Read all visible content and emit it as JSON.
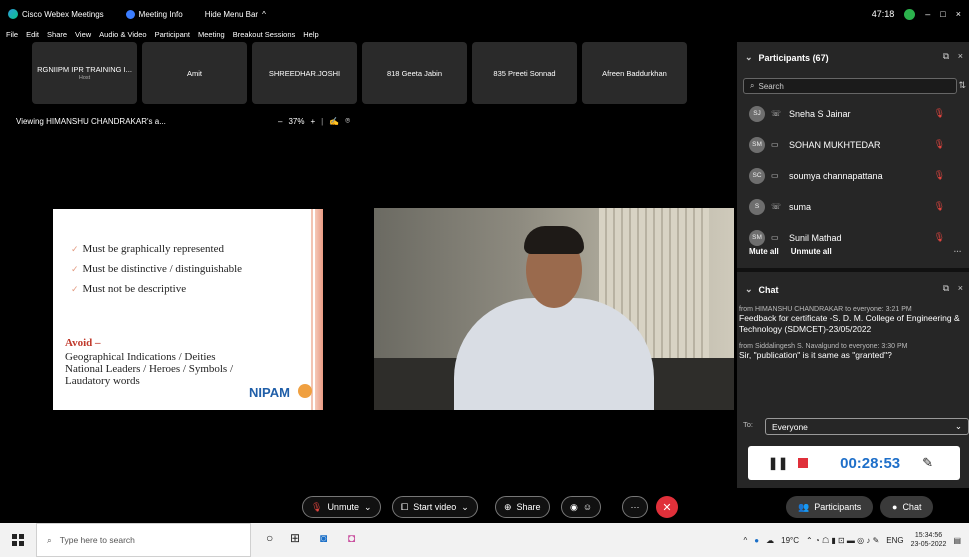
{
  "titlebar": {
    "app_name": "Cisco Webex Meetings",
    "meeting_info": "Meeting Info",
    "hide_menu": "Hide Menu Bar",
    "hide_menu_chev": "^",
    "timer": "47:18",
    "minimize": "–",
    "maximize": "□",
    "close": "×"
  },
  "menu": [
    "File",
    "Edit",
    "Share",
    "View",
    "Audio & Video",
    "Participant",
    "Meeting",
    "Breakout Sessions",
    "Help"
  ],
  "tiles": [
    {
      "name": "RGNIIPM IPR TRAINING I...",
      "sub": "Host"
    },
    {
      "name": "Amit",
      "sub": ""
    },
    {
      "name": "SHREEDHAR.JOSHI",
      "sub": ""
    },
    {
      "name": "818 Geeta Jabin",
      "sub": ""
    },
    {
      "name": "835 Preeti Sonnad",
      "sub": ""
    },
    {
      "name": "Afreen Baddurkhan",
      "sub": ""
    }
  ],
  "viewing": {
    "label": "Viewing HIMANSHU CHANDRAKAR's a...",
    "zoom_out": "–",
    "zoom": "37%",
    "zoom_in": "+"
  },
  "slide": {
    "bullets": [
      "Must be graphically represented",
      "Must be distinctive / distinguishable",
      "Must not be descriptive"
    ],
    "tick": "✓",
    "avoid_title": "Avoid –",
    "avoid_lines": [
      "Geographical Indications / Deities",
      "National Leaders / Heroes /  Symbols /",
      "Laudatory words"
    ],
    "logo_text": "NIPAM"
  },
  "participants": {
    "title": "Participants (67)",
    "search_placeholder": "Search",
    "items": [
      {
        "initials": "SJ",
        "name": "Sneha S Jainar",
        "device": "phone"
      },
      {
        "initials": "SM",
        "name": "SOHAN MUKHTEDAR",
        "device": "desktop"
      },
      {
        "initials": "SC",
        "name": "soumya channapattana",
        "device": "desktop"
      },
      {
        "initials": "S",
        "name": "suma",
        "device": "phone"
      },
      {
        "initials": "SM",
        "name": "Sunil Mathad",
        "device": "desktop"
      }
    ],
    "mute_all": "Mute all",
    "unmute_all": "Unmute all",
    "more": "···"
  },
  "chat": {
    "title": "Chat",
    "messages": [
      {
        "header": "from HIMANSHU CHANDRAKAR to everyone:   3:21 PM",
        "body": "Feedback for certificate -S. D. M. College of Engineering & Technology (SDMCET)-23/05/2022"
      },
      {
        "header": "from Siddalingesh S. Navalgund to everyone:   3:30 PM",
        "body": "Sir, \"publication\" is it same as \"granted\"?"
      }
    ],
    "to_label": "To:",
    "to_value": "Everyone",
    "rec_time": "00:28:53"
  },
  "controls": {
    "unmute": "Unmute",
    "start_video": "Start video",
    "share": "Share",
    "more": "···",
    "participants": "Participants",
    "chat": "Chat"
  },
  "taskbar": {
    "search_placeholder": "Type here to search",
    "weather": "19°C",
    "lang": "ENG",
    "time": "15:34:56",
    "date": "23-05-2022"
  }
}
